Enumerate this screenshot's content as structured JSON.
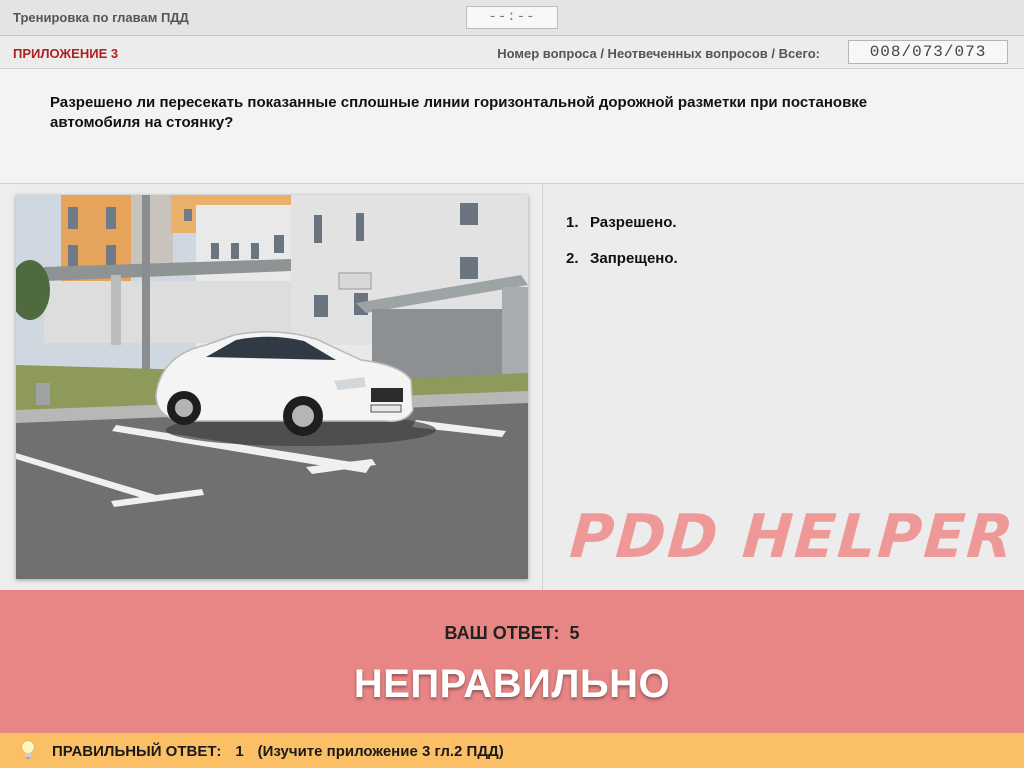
{
  "header": {
    "title": "Тренировка по главам ПДД",
    "timer": "--:--"
  },
  "subheader": {
    "appendix": "ПРИЛОЖЕНИЕ 3",
    "counter_label": "Номер вопроса / Неотвеченных вопросов / Всего:",
    "counter_value": "008/073/073"
  },
  "question": {
    "text": "Разрешено ли пересекать показанные сплошные линии горизонтальной дорожной разметки при постановке автомобиля на стоянку?"
  },
  "answers": [
    {
      "num": "1.",
      "label": "Разрешено."
    },
    {
      "num": "2.",
      "label": "Запрещено."
    }
  ],
  "watermark": "PDD HELPER",
  "result": {
    "your_label": "ВАШ  ОТВЕТ:",
    "your_value": "5",
    "verdict": "НЕПРАВИЛЬНО"
  },
  "footer": {
    "correct_label": "ПРАВИЛЬНЫЙ ОТВЕТ:",
    "correct_value": "1",
    "hint": "(Изучите приложение 3 гл.2 ПДД)",
    "icon": "lightbulb-icon"
  },
  "colors": {
    "accent_red": "#b0201c",
    "result_bg": "#e88686",
    "footer_bg": "#fbbf66",
    "watermark": "#f09090"
  }
}
